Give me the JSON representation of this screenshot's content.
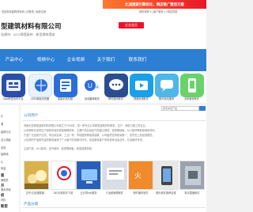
{
  "topbar": {
    "left_links": "欢迎来到建筑材料网 | 请登录 | 免费注册",
    "right_links": "我的采购 ▾  |  客户服务 ▾  |  网站导航",
    "promo_text": "北流搜索引擎优化，网店推广策划方案"
  },
  "header": {
    "company_name": "型建筑材料有限公司",
    "company_sub": "化建材、ACC隔墙板材、新型建筑墙体",
    "badge_label": "企业会员"
  },
  "nav": {
    "items": [
      "产品中心",
      "视频中心",
      "企业视频",
      "关于我们",
      "联系我们"
    ]
  },
  "apps": [
    {
      "label": "Tapd研发协作平台",
      "color": "#2b4fa8",
      "icon": "tapd-app-icon"
    },
    {
      "label": "2020新版浏览器",
      "color": "#e9f2fb",
      "icon": "browser-app-icon"
    },
    {
      "label": "智能手机扫描",
      "color": "#2a6fd8",
      "icon": "scan-app-icon"
    },
    {
      "label": "自动翻译软件",
      "color": "#ffffff",
      "icon": "translate-app-icon"
    },
    {
      "label": "即时通讯软件",
      "color": "#2a4d8f",
      "icon": "chat-app-icon"
    },
    {
      "label": "视频剪辑软件",
      "color": "#1aa0e8",
      "icon": "video-app-icon"
    },
    {
      "label": "聊天网站推荐",
      "color": "#4fb6e8",
      "icon": "chat-web-app-icon"
    },
    {
      "label": "手机管家软件",
      "color": "#6ad26a",
      "icon": "phone-app-icon"
    }
  ],
  "sidebar": {
    "lines": [
      "片",
      "凝",
      "建筑行业",
      "空心墙板",
      "发泡",
      "建筑墙",
      "片",
      "保温",
      "管理员",
      "凝多多新",
      "材料"
    ],
    "strong": [
      "装",
      "开",
      "机",
      "新型"
    ]
  },
  "search": {
    "placeholder": "搜索本店产品"
  },
  "main": {
    "intro_title": "公司简介",
    "intro_lines": [
      "河南天安新型建筑材料有限公司成立于2018年，是一家专业从事新型建筑材料研发、生产、销售与施工的企业，",
      "公司拥有先进的生产线和完善的质量管理体系，主要产品包括加气混凝土砌块、轻质隔墙板、ALC板材等新型墙体材料，",
      "产品广泛应用于住宅、商业综合体、工业厂房、学校医院等各类建筑，公司始终坚持质量第一、信誉至上的经营理念，",
      "以优质的产品和完善的服务赢得了广大客户的信赖与好评，欢迎新老客户来电咨询洽谈合作，共创美好未来。",
      "主营产品：ALC板材、加气砌块、轻质隔墙板、新型建筑墙体。"
    ],
    "thumbs": [
      {
        "label": "正宗-亿佰通集团 ...",
        "color": "#d8b24a"
      },
      {
        "label": "360手机助手下载",
        "color": "#ffffff"
      },
      {
        "label": "云计算cdn服务",
        "color": "#2a5fb8"
      },
      {
        "label": "IT运维管理软件",
        "color": "#d8dde6"
      },
      {
        "label": "即时通讯软件",
        "color": "#f08a2a"
      },
      {
        "label": "聊天软件推荐合集",
        "color": "#e8e8e8"
      },
      {
        "label": "新手直播软件",
        "color": "#9aa3ad"
      }
    ],
    "products_title": "产品分类"
  },
  "colors": {
    "nav_blue": "#2d7fd3",
    "promo_red": "#e8142a",
    "promo_orange": "#ff7a2f"
  }
}
